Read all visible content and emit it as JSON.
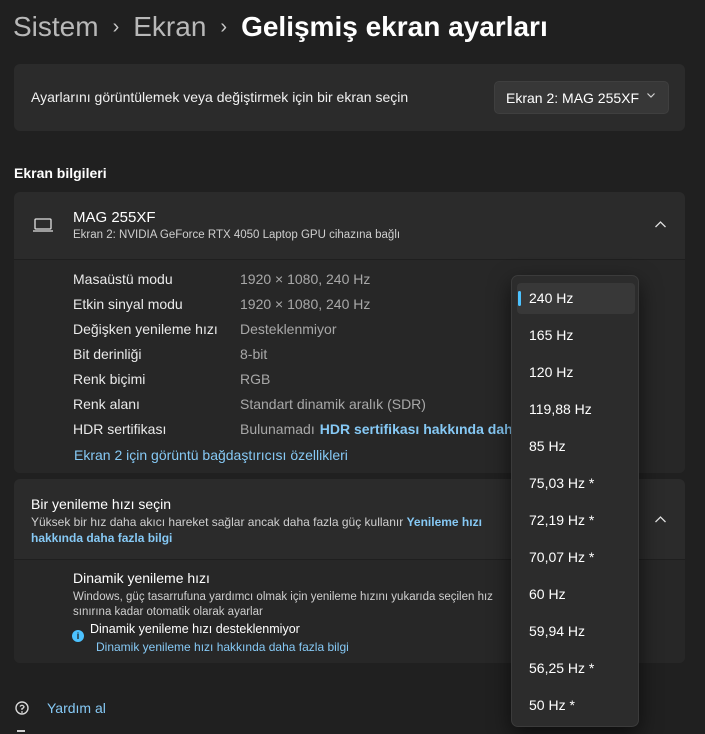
{
  "breadcrumb": {
    "item1": "Sistem",
    "item2": "Ekran",
    "current": "Gelişmiş ekran ayarları"
  },
  "display_select": {
    "label": "Ayarlarını görüntülemek veya değiştirmek için bir ekran seçin",
    "value": "Ekran 2: MAG 255XF"
  },
  "display_info": {
    "section_title": "Ekran bilgileri",
    "monitor_name": "MAG 255XF",
    "monitor_subtitle": "Ekran 2: NVIDIA GeForce RTX 4050 Laptop GPU cihazına bağlı",
    "rows": [
      {
        "key": "Masaüstü modu",
        "value": "1920 × 1080, 240 Hz"
      },
      {
        "key": "Etkin sinyal modu",
        "value": "1920 × 1080, 240 Hz"
      },
      {
        "key": "Değişken yenileme hızı",
        "value": "Desteklenmiyor"
      },
      {
        "key": "Bit derinliği",
        "value": "8-bit"
      },
      {
        "key": "Renk biçimi",
        "value": "RGB"
      },
      {
        "key": "Renk alanı",
        "value": "Standart dinamik aralık (SDR)"
      },
      {
        "key": "HDR sertifikası",
        "value": "Bulunamadı",
        "link": "HDR sertifikası hakkında daha fazla bilgi"
      }
    ],
    "adapter_link": "Ekran 2 için görüntü bağdaştırıcısı özellikleri"
  },
  "refresh": {
    "title": "Bir yenileme hızı seçin",
    "desc": "Yüksek bir hız daha akıcı hareket sağlar ancak daha fazla güç kullanır",
    "link": "Yenileme hızı hakkında daha fazla bilgi",
    "dynamic_title": "Dinamik yenileme hızı",
    "dynamic_desc": "Windows, güç tasarrufuna yardımcı olmak için yenileme hızını yukarıda seçilen hız sınırına kadar otomatik olarak ayarlar",
    "dynamic_status": "Dinamik yenileme hızı desteklenmiyor",
    "dynamic_link": "Dinamik yenileme hızı hakkında daha fazla bilgi"
  },
  "help": {
    "label": "Yardım al"
  },
  "refresh_options": {
    "selected": "240 Hz",
    "items": [
      "240 Hz",
      "165 Hz",
      "120 Hz",
      "119,88 Hz",
      "85 Hz",
      "75,03 Hz *",
      "72,19 Hz *",
      "70,07 Hz *",
      "60 Hz",
      "59,94 Hz",
      "56,25 Hz *",
      "50 Hz *"
    ]
  },
  "colors": {
    "background": "#202020",
    "card": "#2b2b2b",
    "accent": "#4cc2ff",
    "link": "#86c9f5"
  }
}
